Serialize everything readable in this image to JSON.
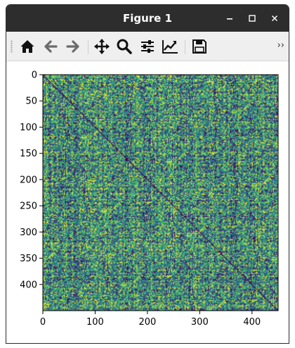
{
  "window": {
    "title": "Figure 1"
  },
  "window_controls": {
    "minimize": "–",
    "maximize": "☐",
    "close": "×"
  },
  "toolbar": {
    "items": [
      "home-icon",
      "back-arrow-icon",
      "forward-arrow-icon",
      "pan-move-icon",
      "zoom-magnifier-icon",
      "configure-subplots-icon",
      "edit-axis-line-icon",
      "save-disk-icon"
    ],
    "overflow": "››"
  },
  "chart_data": {
    "type": "heatmap",
    "description": "square matrix with bright diagonal",
    "matrix_size": 450,
    "colormap": "viridis",
    "colors": [
      "#440154",
      "#3b528b",
      "#21918c",
      "#5ec962",
      "#fde725"
    ],
    "diagonal_color": "#440154",
    "x_ticks": [
      "0",
      "100",
      "200",
      "300",
      "400"
    ],
    "y_ticks": [
      "0",
      "50",
      "100",
      "150",
      "200",
      "250",
      "300",
      "350",
      "400"
    ],
    "xlim": [
      0,
      450
    ],
    "ylim": [
      450,
      0
    ]
  }
}
